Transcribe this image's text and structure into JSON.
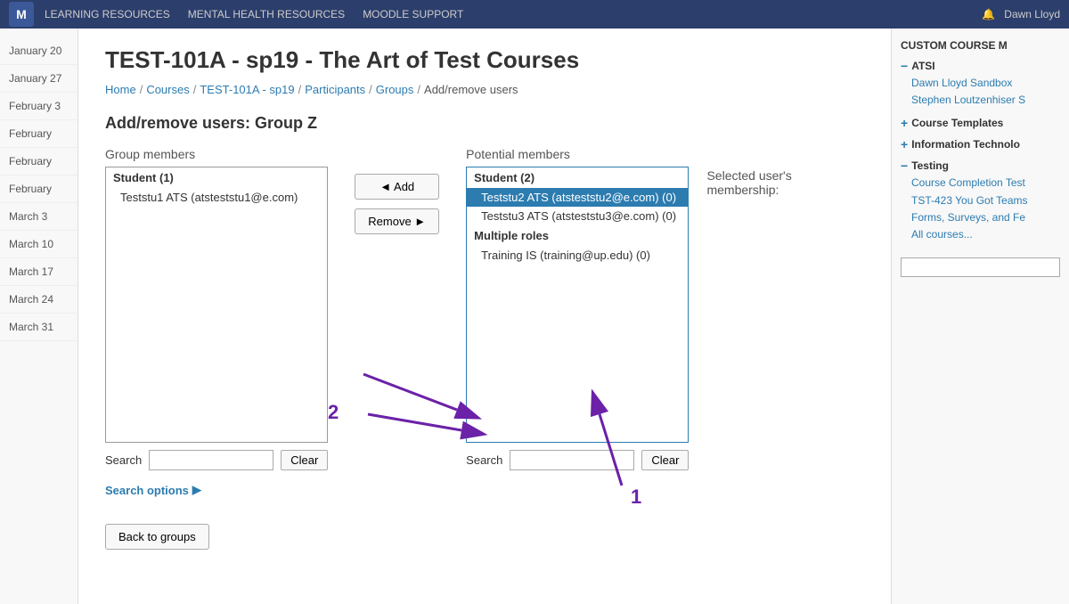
{
  "topnav": {
    "logo_text": "M",
    "nav_items": [
      "LEARNING RESOURCES",
      "MENTAL HEALTH RESOURCES",
      "MOODLE SUPPORT"
    ],
    "user_name": "Dawn Lloyd",
    "notification_icon": "bell"
  },
  "breadcrumb": {
    "items": [
      "Home",
      "Courses",
      "TEST-101A - sp19",
      "Participants",
      "Groups",
      "Add/remove users"
    ],
    "separators": [
      "/",
      "/",
      "/",
      "/",
      "/"
    ]
  },
  "page": {
    "title": "TEST-101A - sp19 - The Art of Test Courses",
    "section_title": "Add/remove users: Group Z"
  },
  "group_members": {
    "label": "Group members",
    "group_label": "Student (1)",
    "members": [
      "Teststu1 ATS (atsteststu1@e.com)"
    ]
  },
  "buttons": {
    "add_label": "◄ Add",
    "remove_label": "Remove ►"
  },
  "potential_members": {
    "label": "Potential members",
    "student_label": "Student (2)",
    "students": [
      "Teststu2 ATS (atsteststu2@e.com) (0)",
      "Teststu3 ATS (atsteststu3@e.com) (0)"
    ],
    "multiple_roles_label": "Multiple roles",
    "multiple_roles_members": [
      "Training IS (training@up.edu) (0)"
    ],
    "selected_index": 0
  },
  "selected_membership": {
    "label": "Selected user's membership:"
  },
  "search_left": {
    "label": "Search",
    "placeholder": "",
    "clear_label": "Clear",
    "options_label": "Search options"
  },
  "search_right": {
    "label": "Search",
    "placeholder": "",
    "clear_label": "Clear"
  },
  "back_button": {
    "label": "Back to groups"
  },
  "right_sidebar": {
    "heading": "CUSTOM COURSE M",
    "sections": [
      {
        "name": "ATSI",
        "toggle": "−",
        "links": [
          "Dawn Lloyd Sandbox",
          "Stephen Loutzenhiser S"
        ]
      },
      {
        "name": "Course Templates",
        "toggle": "+"
      },
      {
        "name": "Information Technolo",
        "toggle": "+"
      },
      {
        "name": "Testing",
        "toggle": "−",
        "links": [
          "Course Completion Test",
          "TST-423 You Got Teams",
          "Forms, Surveys, and Fe",
          "All courses..."
        ]
      }
    ]
  },
  "sidebar_left": {
    "items": [
      "January 20",
      "January 27",
      "February 3",
      "February",
      "February",
      "February",
      "March 3",
      "March 10",
      "March 17",
      "March 24",
      "March 31"
    ]
  },
  "annotations": {
    "label1": "1",
    "label2": "2"
  }
}
